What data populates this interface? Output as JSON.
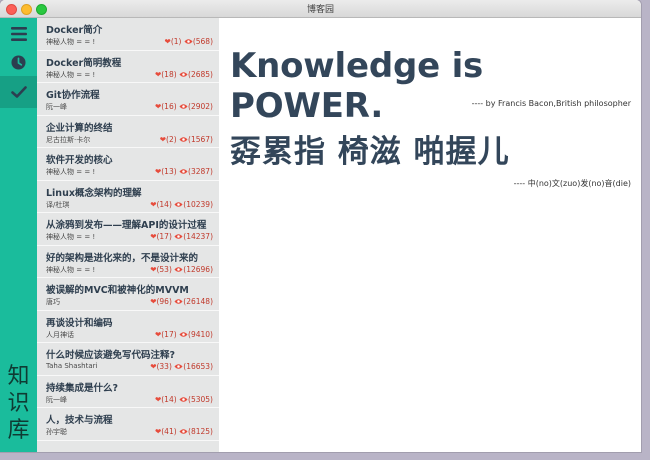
{
  "window": {
    "title": "博客园"
  },
  "sidebar": {
    "brand": "知识库",
    "buttons": [
      "menu-icon",
      "clock-icon",
      "check-icon"
    ],
    "colors": {
      "sidebar": "#1abc9c",
      "active": "#16a085"
    }
  },
  "articles": [
    {
      "title": "Docker简介",
      "author": "神秘人物 = = !",
      "likes": "(1)",
      "views": "(568)"
    },
    {
      "title": "Docker简明教程",
      "author": "神秘人物 = = !",
      "likes": "(18)",
      "views": "(2685)"
    },
    {
      "title": "Git协作流程",
      "author": "阮一峰",
      "likes": "(16)",
      "views": "(2902)"
    },
    {
      "title": "企业计算的终结",
      "author": "尼古拉斯·卡尔",
      "likes": "(2)",
      "views": "(1567)"
    },
    {
      "title": "软件开发的核心",
      "author": "神秘人物 = = !",
      "likes": "(13)",
      "views": "(3287)"
    },
    {
      "title": "Linux概念架构的理解",
      "author": "译/杜琪",
      "likes": "(14)",
      "views": "(10239)"
    },
    {
      "title": "从涂鸦到发布——理解API的设计过程",
      "author": "神秘人物 = = !",
      "likes": "(17)",
      "views": "(14237)"
    },
    {
      "title": "好的架构是进化来的，不是设计来的",
      "author": "神秘人物 = = !",
      "likes": "(53)",
      "views": "(12696)"
    },
    {
      "title": "被误解的MVC和被神化的MVVM",
      "author": "唐巧",
      "likes": "(96)",
      "views": "(26148)"
    },
    {
      "title": "再谈设计和编码",
      "author": "人月神话",
      "likes": "(17)",
      "views": "(9410)"
    },
    {
      "title": "什么时候应该避免写代码注释?",
      "author": "Taha Shashtari",
      "likes": "(33)",
      "views": "(16653)"
    },
    {
      "title": "持续集成是什么?",
      "author": "阮一峰",
      "likes": "(14)",
      "views": "(5305)"
    },
    {
      "title": "人，技术与流程",
      "author": "孙宇聪",
      "likes": "(41)",
      "views": "(8125)"
    }
  ],
  "content": {
    "quote1": "Knowledge is POWER.",
    "source1": "---- by Francis Bacon,British philosopher",
    "quote2": "孬累指 椅滋 啪握儿",
    "source2": "---- 中(no)文(zuo)发(no)音(die)"
  }
}
